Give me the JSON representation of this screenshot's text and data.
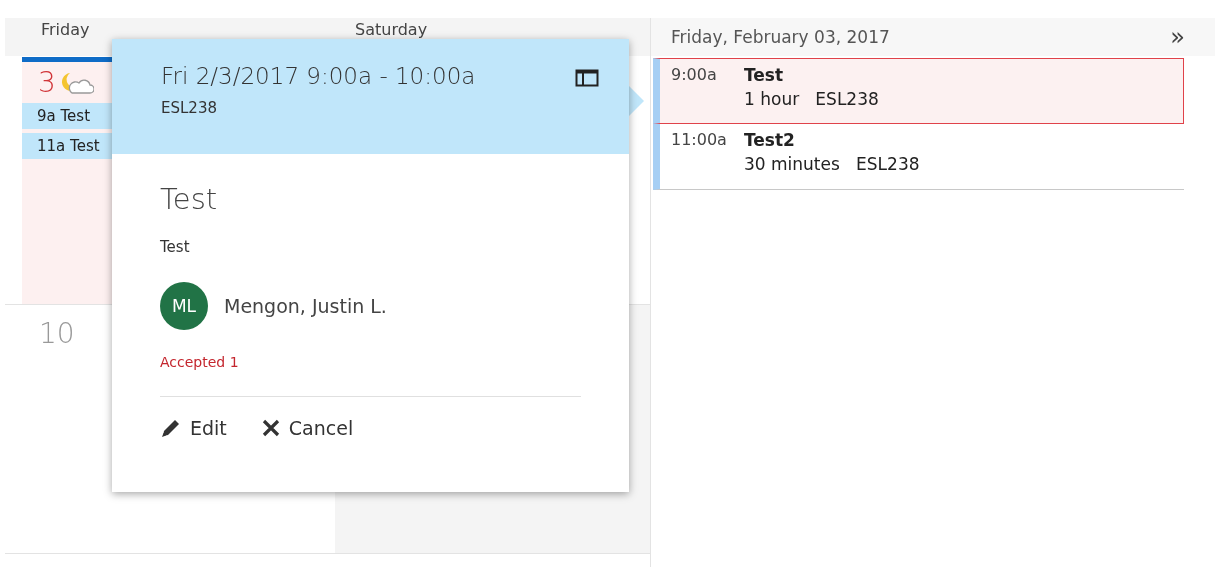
{
  "month_grid": {
    "day_headers": [
      "Friday",
      "Saturday"
    ],
    "weeks": [
      {
        "days": [
          {
            "date": "3",
            "today": true,
            "weather": true,
            "events": [
              {
                "label": "9a Test"
              },
              {
                "label": "11a Test"
              }
            ]
          }
        ]
      },
      {
        "days": [
          {
            "date": "10",
            "today": false,
            "weather": false
          },
          {
            "today": false,
            "weather": false
          }
        ]
      }
    ]
  },
  "popup": {
    "when": "Fri 2/3/2017 9:00a - 10:00a",
    "location": "ESL238",
    "title": "Test",
    "description": "Test",
    "organizer": {
      "initials": "ML",
      "name": "Mengon, Justin L.",
      "color": "#217346"
    },
    "response": "Accepted 1",
    "actions": [
      {
        "kind": "edit",
        "label": "Edit"
      },
      {
        "kind": "cancel",
        "label": "Cancel"
      }
    ]
  },
  "agenda": {
    "date": "Friday, February 03, 2017",
    "next": "»",
    "items": [
      {
        "time": "9:00a",
        "title": "Test",
        "duration": "1 hour",
        "location": "ESL238",
        "selected": true
      },
      {
        "time": "11:00a",
        "title": "Test2",
        "duration": "30 minutes",
        "location": "ESL238",
        "selected": false
      }
    ]
  }
}
